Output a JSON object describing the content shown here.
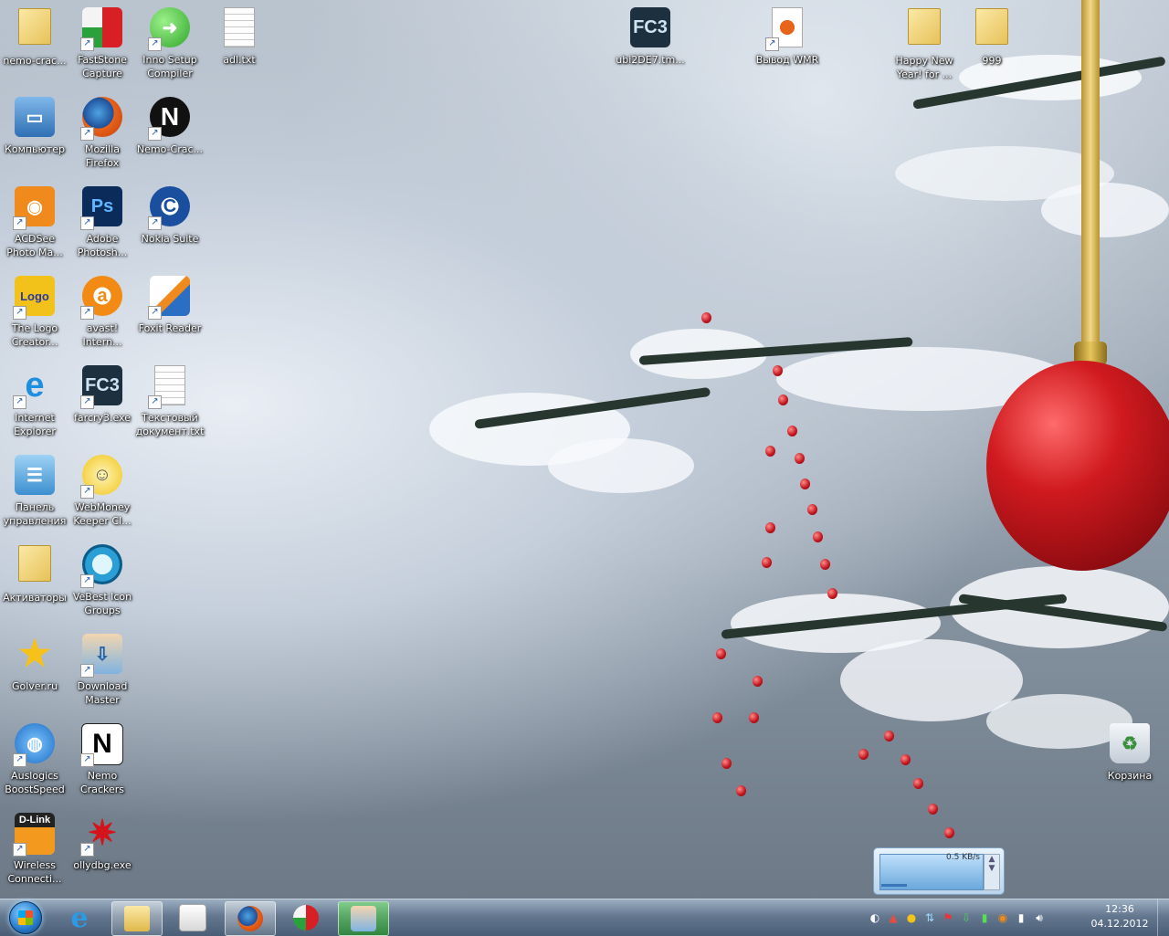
{
  "desktop": {
    "icons": [
      {
        "label": "nemo-crac...",
        "icon": "user-folder-icon"
      },
      {
        "label": "FastStone Capture",
        "icon": "faststone-capture-icon"
      },
      {
        "label": "Inno Setup Compiler",
        "icon": "inno-setup-icon"
      },
      {
        "label": "adl.txt",
        "icon": "text-file-icon"
      },
      {
        "label": "ubi2DE7.tm...",
        "icon": "fc3-icon"
      },
      {
        "label": "Вывод WMR",
        "icon": "firefox-document-icon"
      },
      {
        "label": "Happy New Year! for ...",
        "icon": "folder-icon"
      },
      {
        "label": "999",
        "icon": "folder-icon"
      },
      {
        "label": "Компьютер",
        "icon": "computer-icon"
      },
      {
        "label": "Mozilla Firefox",
        "icon": "firefox-icon"
      },
      {
        "label": "Nemo-Crac...",
        "icon": "nemo-icon"
      },
      {
        "label": "ACDSee Photo Ma...",
        "icon": "acdsee-icon"
      },
      {
        "label": "Adobe Photosh...",
        "icon": "photoshop-icon"
      },
      {
        "label": "Nokia Suite",
        "icon": "nokia-suite-icon"
      },
      {
        "label": "The Logo Creator...",
        "icon": "logo-creator-icon"
      },
      {
        "label": "avast! Intern...",
        "icon": "avast-icon"
      },
      {
        "label": "Foxit Reader",
        "icon": "foxit-reader-icon"
      },
      {
        "label": "Internet Explorer",
        "icon": "internet-explorer-icon"
      },
      {
        "label": "farcry3.exe",
        "icon": "fc3-icon"
      },
      {
        "label": "Текстовый документ.txt",
        "icon": "text-file-icon"
      },
      {
        "label": "Панель управления",
        "icon": "control-panel-icon"
      },
      {
        "label": "WebMoney Keeper Cl...",
        "icon": "webmoney-icon"
      },
      {
        "label": "Активаторы",
        "icon": "folder-icon"
      },
      {
        "label": "VeBest Icon Groups",
        "icon": "vebest-icon"
      },
      {
        "label": "Golver.ru",
        "icon": "star-icon"
      },
      {
        "label": "Download Master",
        "icon": "download-master-icon"
      },
      {
        "label": "Auslogics BoostSpeed",
        "icon": "auslogics-icon"
      },
      {
        "label": "Nemo Crackers",
        "icon": "nemo-icon"
      },
      {
        "label": "Wireless Connecti...",
        "icon": "dlink-icon"
      },
      {
        "label": "ollydbg.exe",
        "icon": "ollydbg-icon"
      },
      {
        "label": "Корзина",
        "icon": "recycle-bin-icon"
      }
    ]
  },
  "net_widget": {
    "rate": "0.5 KB/s"
  },
  "taskbar": {
    "pinned": [
      "internet-explorer-icon",
      "explorer-folder-icon",
      "media-player-icon",
      "firefox-icon",
      "faststone-capture-icon",
      "download-master-icon"
    ],
    "tray_icons": [
      "nokia-suite-icon",
      "faststone-icon",
      "webmoney-icon",
      "network-icon",
      "flag-icon",
      "download-icon",
      "signal-icon",
      "avast-icon",
      "signal-bars-icon",
      "volume-icon"
    ],
    "clock_time": "12:36",
    "clock_date": "04.12.2012"
  },
  "colors": {
    "accent": "#2a7fd0",
    "ornament": "#d01a1f"
  }
}
